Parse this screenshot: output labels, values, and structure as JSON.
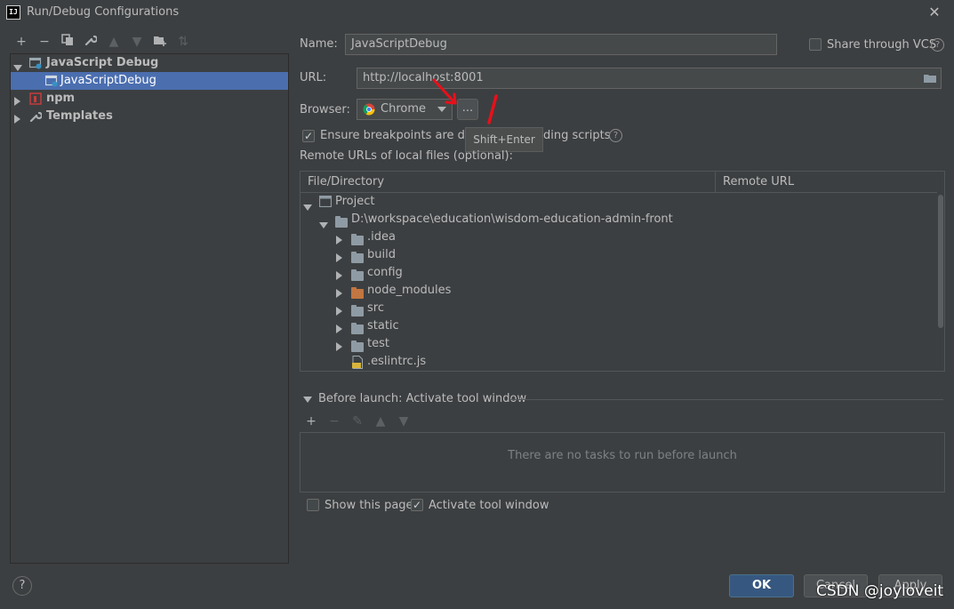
{
  "window": {
    "title": "Run/Debug Configurations",
    "app_icon_text": "IJ"
  },
  "toolbar": {
    "icons": [
      "add-icon",
      "remove-icon",
      "copy-icon",
      "wrench-icon",
      "move-up-icon",
      "move-down-icon",
      "new-folder-icon",
      "sort-icon"
    ]
  },
  "tree": {
    "items": [
      {
        "label": "JavaScript Debug",
        "bold": true
      },
      {
        "label": "JavaScriptDebug",
        "selected": true
      },
      {
        "label": "npm",
        "bold": true
      },
      {
        "label": "Templates",
        "bold": true
      }
    ]
  },
  "form": {
    "name_label": "Name:",
    "name_value": "JavaScriptDebug",
    "share_label": "Share through VCS",
    "url_label": "URL:",
    "url_value": "http://localhost:8001",
    "browser_label": "Browser:",
    "browser_value": "Chrome",
    "ellipsis_label": "...",
    "tooltip_text": "Shift+Enter",
    "breakpoints_label": "Ensure breakpoints are dete",
    "breakpoints_label_tail": "ding scripts",
    "remote_urls_label": "Remote URLs of local files (optional):"
  },
  "table": {
    "columns": [
      "File/Directory",
      "Remote URL"
    ],
    "rows": [
      {
        "label": "Project",
        "indent": 0,
        "expanded": true,
        "icon": "project-icon"
      },
      {
        "label": "D:\\workspace\\education\\wisdom-education-admin-front",
        "indent": 1,
        "expanded": true,
        "icon": "folder-icon"
      },
      {
        "label": ".idea",
        "indent": 2,
        "expanded": false,
        "icon": "folder-icon"
      },
      {
        "label": "build",
        "indent": 2,
        "expanded": false,
        "icon": "folder-icon"
      },
      {
        "label": "config",
        "indent": 2,
        "expanded": false,
        "icon": "folder-icon"
      },
      {
        "label": "node_modules",
        "indent": 2,
        "expanded": false,
        "icon": "excluded-folder-icon"
      },
      {
        "label": "src",
        "indent": 2,
        "expanded": false,
        "icon": "folder-icon"
      },
      {
        "label": "static",
        "indent": 2,
        "expanded": false,
        "icon": "folder-icon"
      },
      {
        "label": "test",
        "indent": 2,
        "expanded": false,
        "icon": "folder-icon"
      },
      {
        "label": ".eslintrc.js",
        "indent": 2,
        "leaf": true,
        "icon": "js-file-icon"
      }
    ]
  },
  "before_launch": {
    "title": "Before launch: Activate tool window",
    "empty_text": "There are no tasks to run before launch",
    "show_page_label": "Show this page",
    "activate_label": "Activate tool window"
  },
  "buttons": {
    "ok": "OK",
    "cancel": "Cancel",
    "apply": "Apply"
  },
  "watermark": "CSDN @joyloveit",
  "colors": {
    "accent": "#4b6eaf",
    "background": "#3c3f41",
    "field": "#45494a",
    "arrow": "#e8101a"
  }
}
